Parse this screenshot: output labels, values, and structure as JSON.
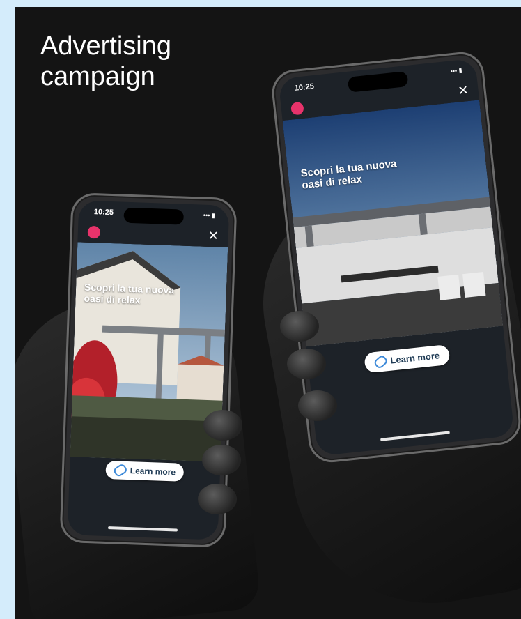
{
  "page": {
    "title": "Advertising campaign"
  },
  "phone_left": {
    "time": "10:25",
    "signal": "••• ▮",
    "headline": "Scopri la tua nuova oasi di relax",
    "cta_label": "Learn more"
  },
  "phone_right": {
    "time": "10:25",
    "signal": "••• ▮",
    "headline": "Scopri la tua nuova oasi di relax",
    "cta_label": "Learn more"
  },
  "colors": {
    "background": "#141414",
    "outer": "#d4ecfb",
    "accent": "#e8336b",
    "cta_icon": "#3d8ad9"
  }
}
